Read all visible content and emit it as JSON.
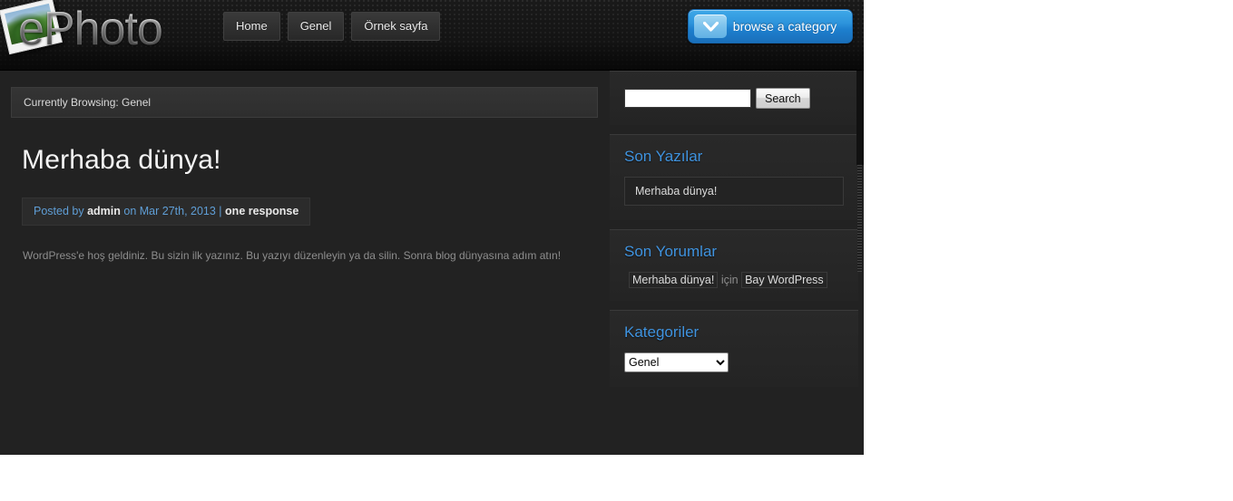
{
  "header": {
    "logo_text": "ePhoto",
    "logo_icon": "photo-icon",
    "nav": [
      {
        "label": "Home"
      },
      {
        "label": "Genel"
      },
      {
        "label": "Örnek sayfa"
      }
    ],
    "browse_button": {
      "label": "browse a category",
      "icon": "chevron-down-icon"
    }
  },
  "content": {
    "breadcrumb": "Currently Browsing: Genel",
    "post": {
      "title": "Merhaba dünya!",
      "meta": {
        "posted_by": "Posted by",
        "author": "admin",
        "on_date": "on Mar 27th, 2013 |",
        "responses": "one response"
      },
      "body": "WordPress'e hoş geldiniz. Bu sizin ilk yazınız. Bu yazıyı düzenleyin ya da silin. Sonra blog dünyasına adım atın!"
    }
  },
  "sidebar": {
    "search": {
      "value": "",
      "placeholder": "",
      "button_label": "Search"
    },
    "recent_posts": {
      "title": "Son Yazılar",
      "items": [
        "Merhaba dünya!"
      ]
    },
    "recent_comments": {
      "title": "Son Yorumlar",
      "comment_post": "Merhaba dünya!",
      "comment_connector": "için",
      "comment_author": "Bay WordPress"
    },
    "categories": {
      "title": "Kategoriler",
      "selected": "Genel",
      "options": [
        "Genel"
      ]
    }
  },
  "colors": {
    "accent_blue": "#3f93df",
    "button_blue": "#2d94dc",
    "page_bg": "#222222",
    "header_bg": "#161616"
  }
}
